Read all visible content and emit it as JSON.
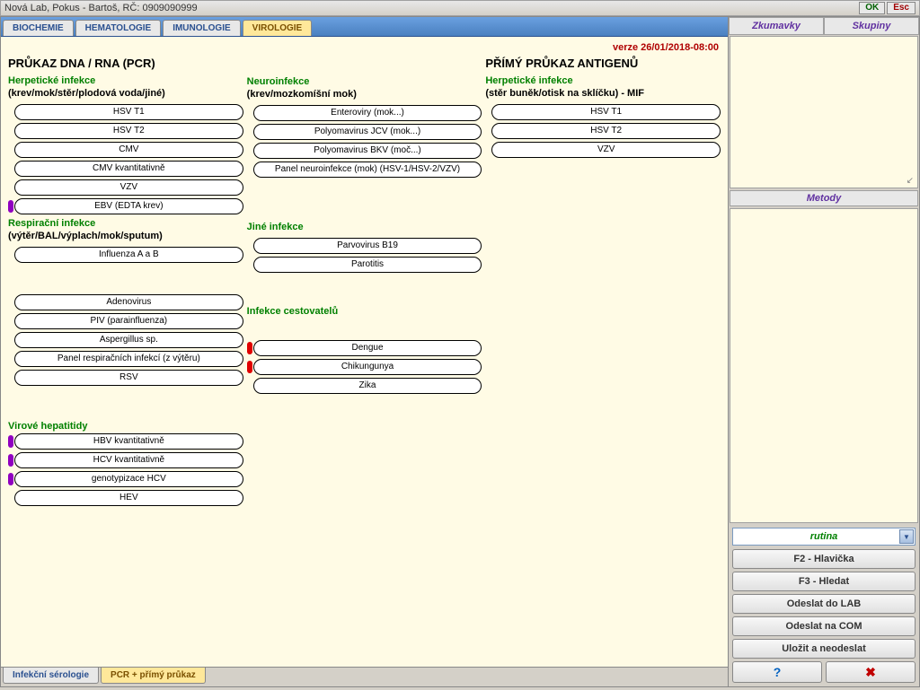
{
  "title": "Nová  Lab,   Pokus - Bartoš, RČ: 0909090999",
  "titlebar_buttons": {
    "ok": "OK",
    "esc": "Esc"
  },
  "top_tabs": [
    "BIOCHEMIE",
    "HEMATOLOGIE",
    "IMUNOLOGIE",
    "VIROLOGIE"
  ],
  "top_tab_active": 3,
  "version": "verze 26/01/2018-08:00",
  "columns": {
    "col1": {
      "title": "PRŮKAZ DNA / RNA (PCR)",
      "sections": [
        {
          "heading": "Herpetické infekce",
          "sub": "(krev/mok/stěr/plodová voda/jiné)",
          "items": [
            {
              "label": "HSV T1"
            },
            {
              "label": "HSV T2"
            },
            {
              "label": "CMV"
            },
            {
              "label": "CMV kvantitativně"
            },
            {
              "label": "VZV"
            },
            {
              "label": "EBV (EDTA krev)",
              "marker": "purple"
            }
          ]
        },
        {
          "heading": "Respirační infekce",
          "sub": "(výtěr/BAL/výplach/mok/sputum)",
          "items": [
            {
              "label": "Influenza A a B"
            }
          ]
        },
        {
          "heading": "",
          "sub": "",
          "gap": true,
          "items": [
            {
              "label": "Adenovirus"
            },
            {
              "label": "PIV (parainfluenza)"
            },
            {
              "label": "Aspergillus sp."
            },
            {
              "label": "Panel respiračních infekcí (z výtěru)"
            },
            {
              "label": "RSV"
            }
          ]
        },
        {
          "heading": "Virové hepatitidy",
          "sub": "",
          "gap": true,
          "items": [
            {
              "label": "HBV kvantitativně",
              "marker": "purple"
            },
            {
              "label": "HCV kvantitativně",
              "marker": "purple"
            },
            {
              "label": "genotypizace HCV",
              "marker": "purple"
            },
            {
              "label": "HEV"
            }
          ]
        }
      ]
    },
    "col2": {
      "title": "",
      "sections": [
        {
          "heading": "Neuroinfekce",
          "sub": "(krev/mozkomíšní mok)",
          "items": [
            {
              "label": "Enteroviry (mok...)"
            },
            {
              "label": "Polyomavirus JCV (mok...)"
            },
            {
              "label": "Polyomavirus BKV (moč...)"
            },
            {
              "label": "Panel neuroinfekce (mok) (HSV-1/HSV-2/VZV)"
            }
          ]
        },
        {
          "heading": "Jiné infekce",
          "sub": " ",
          "items": [
            {
              "label": "Parvovirus B19"
            },
            {
              "label": "Parotitis"
            }
          ]
        },
        {
          "heading": "Infekce cestovatelů",
          "sub": "",
          "gap": true,
          "toponly": true,
          "items": []
        },
        {
          "heading": "",
          "sub": "",
          "items": [
            {
              "label": "Dengue",
              "marker": "red"
            },
            {
              "label": "Chikungunya",
              "marker": "red"
            },
            {
              "label": "Zika"
            }
          ]
        }
      ]
    },
    "col3": {
      "title": "PŘÍMÝ PRŮKAZ ANTIGENŮ",
      "sections": [
        {
          "heading": "Herpetické infekce",
          "sub": "(stěr buněk/otisk na sklíčku) - MIF",
          "items": [
            {
              "label": "HSV T1"
            },
            {
              "label": "HSV T2"
            },
            {
              "label": "VZV"
            }
          ]
        }
      ]
    }
  },
  "bottom_tabs": [
    "Infekční sérologie",
    "PCR + přímý průkaz"
  ],
  "bottom_tab_active": 1,
  "right": {
    "header1": "Zkumavky",
    "header2": "Skupiny",
    "panel_corner": "↙",
    "mid_header": "Metody",
    "dropdown": "rutina",
    "buttons": [
      "F2 - Hlavička",
      "F3 - Hledat",
      "Odeslat do LAB",
      "Odeslat na COM",
      "Uložit a neodeslat"
    ],
    "help": "?",
    "close": "✖"
  }
}
